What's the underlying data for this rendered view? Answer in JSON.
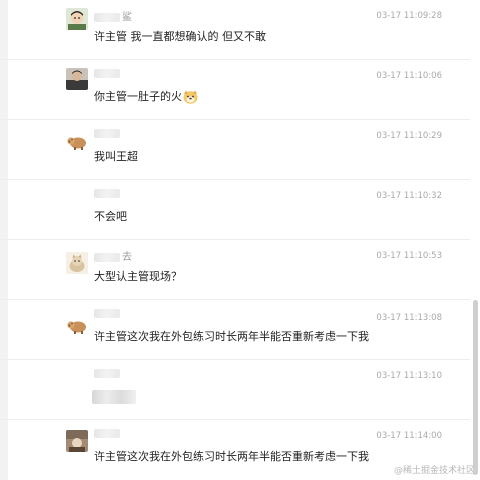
{
  "messages": [
    {
      "name_suffix": "鲨",
      "time": "03-17 11:09:28",
      "text": "许主管   我一直都想确认的 但又不敢"
    },
    {
      "name_suffix": "",
      "time": "03-17 11:10:06",
      "text": "你主管一肚子的火"
    },
    {
      "name_suffix": "",
      "time": "03-17 11:10:29",
      "text": "我叫王超"
    },
    {
      "name_suffix": "",
      "time": "03-17 11:10:32",
      "text": "不会吧"
    },
    {
      "name_suffix": "去",
      "time": "03-17 11:10:53",
      "text": "大型认主管现场？"
    },
    {
      "name_suffix": "",
      "time": "03-17 11:13:08",
      "text": "许主管这次我在外包练习时长两年半能否重新考虑一下我"
    },
    {
      "name_suffix": "",
      "time": "03-17 11:13:10",
      "text": ""
    },
    {
      "name_suffix": "",
      "time": "03-17 11:14:00",
      "text": "许主管这次我在外包练习时长两年半能否重新考虑一下我"
    }
  ],
  "watermark": "@稀土掘金技术社区",
  "icons": {
    "emoji": "doge-face-icon",
    "avatars": [
      "cartoon-man-avatar",
      "portrait-avatar",
      "pig-avatar",
      "blank-avatar",
      "cat-avatar",
      "pig-avatar",
      "blank-avatar",
      "photo-avatar"
    ]
  }
}
